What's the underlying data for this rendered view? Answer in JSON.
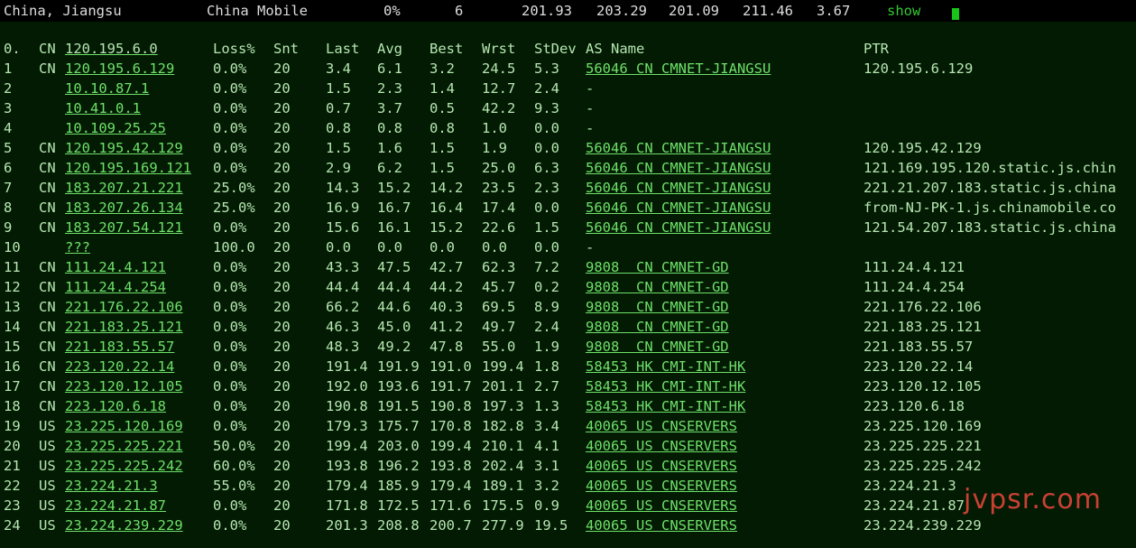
{
  "top": {
    "location": "China, Jiangsu",
    "isp": "China Mobile",
    "loss": "0%",
    "snt": "6",
    "last": "201.93",
    "avg": "203.29",
    "best": "201.09",
    "wrst": "211.46",
    "stdev": "3.67",
    "show": "show"
  },
  "header": {
    "hop": "0.",
    "cc": "CN",
    "host": "120.195.6.0",
    "loss": "Loss%",
    "snt": "Snt",
    "last": "Last",
    "avg": "Avg",
    "best": "Best",
    "wrst": "Wrst",
    "stdev": "StDev",
    "as": "AS Name",
    "ptr": "PTR"
  },
  "rows": [
    {
      "hop": "1",
      "cc": "CN",
      "host": "120.195.6.129",
      "loss": "0.0%",
      "snt": "20",
      "last": "3.4",
      "avg": "6.1",
      "best": "3.2",
      "wrst": "24.5",
      "stdev": "5.3",
      "as": "56046 CN CMNET-JIANGSU",
      "ptr": "120.195.6.129"
    },
    {
      "hop": "2",
      "cc": "",
      "host": "10.10.87.1",
      "loss": "0.0%",
      "snt": "20",
      "last": "1.5",
      "avg": "2.3",
      "best": "1.4",
      "wrst": "12.7",
      "stdev": "2.4",
      "as": "-",
      "ptr": ""
    },
    {
      "hop": "3",
      "cc": "",
      "host": "10.41.0.1",
      "loss": "0.0%",
      "snt": "20",
      "last": "0.7",
      "avg": "3.7",
      "best": "0.5",
      "wrst": "42.2",
      "stdev": "9.3",
      "as": "-",
      "ptr": ""
    },
    {
      "hop": "4",
      "cc": "",
      "host": "10.109.25.25",
      "loss": "0.0%",
      "snt": "20",
      "last": "0.8",
      "avg": "0.8",
      "best": "0.8",
      "wrst": "1.0",
      "stdev": "0.0",
      "as": "-",
      "ptr": ""
    },
    {
      "hop": "5",
      "cc": "CN",
      "host": "120.195.42.129",
      "loss": "0.0%",
      "snt": "20",
      "last": "1.5",
      "avg": "1.6",
      "best": "1.5",
      "wrst": "1.9",
      "stdev": "0.0",
      "as": "56046 CN CMNET-JIANGSU",
      "ptr": "120.195.42.129"
    },
    {
      "hop": "6",
      "cc": "CN",
      "host": "120.195.169.121",
      "loss": "0.0%",
      "snt": "20",
      "last": "2.9",
      "avg": "6.2",
      "best": "1.5",
      "wrst": "25.0",
      "stdev": "6.3",
      "as": "56046 CN CMNET-JIANGSU",
      "ptr": "121.169.195.120.static.js.chin"
    },
    {
      "hop": "7",
      "cc": "CN",
      "host": "183.207.21.221",
      "loss": "25.0%",
      "snt": "20",
      "last": "14.3",
      "avg": "15.2",
      "best": "14.2",
      "wrst": "23.5",
      "stdev": "2.3",
      "as": "56046 CN CMNET-JIANGSU",
      "ptr": "221.21.207.183.static.js.china"
    },
    {
      "hop": "8",
      "cc": "CN",
      "host": "183.207.26.134",
      "loss": "25.0%",
      "snt": "20",
      "last": "16.9",
      "avg": "16.7",
      "best": "16.4",
      "wrst": "17.4",
      "stdev": "0.0",
      "as": "56046 CN CMNET-JIANGSU",
      "ptr": "from-NJ-PK-1.js.chinamobile.co"
    },
    {
      "hop": "9",
      "cc": "CN",
      "host": "183.207.54.121",
      "loss": "0.0%",
      "snt": "20",
      "last": "15.6",
      "avg": "16.1",
      "best": "15.2",
      "wrst": "22.6",
      "stdev": "1.5",
      "as": "56046 CN CMNET-JIANGSU",
      "ptr": "121.54.207.183.static.js.china"
    },
    {
      "hop": "10",
      "cc": "",
      "host": "???",
      "loss": "100.0",
      "snt": "20",
      "last": "0.0",
      "avg": "0.0",
      "best": "0.0",
      "wrst": "0.0",
      "stdev": "0.0",
      "as": "-",
      "ptr": ""
    },
    {
      "hop": "11",
      "cc": "CN",
      "host": "111.24.4.121",
      "loss": "0.0%",
      "snt": "20",
      "last": "43.3",
      "avg": "47.5",
      "best": "42.7",
      "wrst": "62.3",
      "stdev": "7.2",
      "as": "9808  CN CMNET-GD",
      "ptr": "111.24.4.121"
    },
    {
      "hop": "12",
      "cc": "CN",
      "host": "111.24.4.254",
      "loss": "0.0%",
      "snt": "20",
      "last": "44.4",
      "avg": "44.4",
      "best": "44.2",
      "wrst": "45.7",
      "stdev": "0.2",
      "as": "9808  CN CMNET-GD",
      "ptr": "111.24.4.254"
    },
    {
      "hop": "13",
      "cc": "CN",
      "host": "221.176.22.106",
      "loss": "0.0%",
      "snt": "20",
      "last": "66.2",
      "avg": "44.6",
      "best": "40.3",
      "wrst": "69.5",
      "stdev": "8.9",
      "as": "9808  CN CMNET-GD",
      "ptr": "221.176.22.106"
    },
    {
      "hop": "14",
      "cc": "CN",
      "host": "221.183.25.121",
      "loss": "0.0%",
      "snt": "20",
      "last": "46.3",
      "avg": "45.0",
      "best": "41.2",
      "wrst": "49.7",
      "stdev": "2.4",
      "as": "9808  CN CMNET-GD",
      "ptr": "221.183.25.121"
    },
    {
      "hop": "15",
      "cc": "CN",
      "host": "221.183.55.57",
      "loss": "0.0%",
      "snt": "20",
      "last": "48.3",
      "avg": "49.2",
      "best": "47.8",
      "wrst": "55.0",
      "stdev": "1.9",
      "as": "9808  CN CMNET-GD",
      "ptr": "221.183.55.57"
    },
    {
      "hop": "16",
      "cc": "CN",
      "host": "223.120.22.14",
      "loss": "0.0%",
      "snt": "20",
      "last": "191.4",
      "avg": "191.9",
      "best": "191.0",
      "wrst": "199.4",
      "stdev": "1.8",
      "as": "58453 HK CMI-INT-HK",
      "ptr": "223.120.22.14"
    },
    {
      "hop": "17",
      "cc": "CN",
      "host": "223.120.12.105",
      "loss": "0.0%",
      "snt": "20",
      "last": "192.0",
      "avg": "193.6",
      "best": "191.7",
      "wrst": "201.1",
      "stdev": "2.7",
      "as": "58453 HK CMI-INT-HK",
      "ptr": "223.120.12.105"
    },
    {
      "hop": "18",
      "cc": "CN",
      "host": "223.120.6.18",
      "loss": "0.0%",
      "snt": "20",
      "last": "190.8",
      "avg": "191.5",
      "best": "190.8",
      "wrst": "197.3",
      "stdev": "1.3",
      "as": "58453 HK CMI-INT-HK",
      "ptr": "223.120.6.18"
    },
    {
      "hop": "19",
      "cc": "US",
      "host": "23.225.120.169",
      "loss": "0.0%",
      "snt": "20",
      "last": "179.3",
      "avg": "175.7",
      "best": "170.8",
      "wrst": "182.8",
      "stdev": "3.4",
      "as": "40065 US CNSERVERS",
      "ptr": "23.225.120.169"
    },
    {
      "hop": "20",
      "cc": "US",
      "host": "23.225.225.221",
      "loss": "50.0%",
      "snt": "20",
      "last": "199.4",
      "avg": "203.0",
      "best": "199.4",
      "wrst": "210.1",
      "stdev": "4.1",
      "as": "40065 US CNSERVERS",
      "ptr": "23.225.225.221"
    },
    {
      "hop": "21",
      "cc": "US",
      "host": "23.225.225.242",
      "loss": "60.0%",
      "snt": "20",
      "last": "193.8",
      "avg": "196.2",
      "best": "193.8",
      "wrst": "202.4",
      "stdev": "3.1",
      "as": "40065 US CNSERVERS",
      "ptr": "23.225.225.242"
    },
    {
      "hop": "22",
      "cc": "US",
      "host": "23.224.21.3",
      "loss": "55.0%",
      "snt": "20",
      "last": "179.4",
      "avg": "185.9",
      "best": "179.4",
      "wrst": "189.1",
      "stdev": "3.2",
      "as": "40065 US CNSERVERS",
      "ptr": "23.224.21.3"
    },
    {
      "hop": "23",
      "cc": "US",
      "host": "23.224.21.87",
      "loss": "0.0%",
      "snt": "20",
      "last": "171.8",
      "avg": "172.5",
      "best": "171.6",
      "wrst": "175.5",
      "stdev": "0.9",
      "as": "40065 US CNSERVERS",
      "ptr": "23.224.21.87"
    },
    {
      "hop": "24",
      "cc": "US",
      "host": "23.224.239.229",
      "loss": "0.0%",
      "snt": "20",
      "last": "201.3",
      "avg": "208.8",
      "best": "200.7",
      "wrst": "277.9",
      "stdev": "19.5",
      "as": "40065 US CNSERVERS",
      "ptr": "23.224.239.229"
    }
  ],
  "watermark": "jvpsr.com",
  "colors": {
    "background": "#021b02",
    "text": "#b7e6b2",
    "link": "#6fe06a",
    "watermark": "#e0453a"
  }
}
